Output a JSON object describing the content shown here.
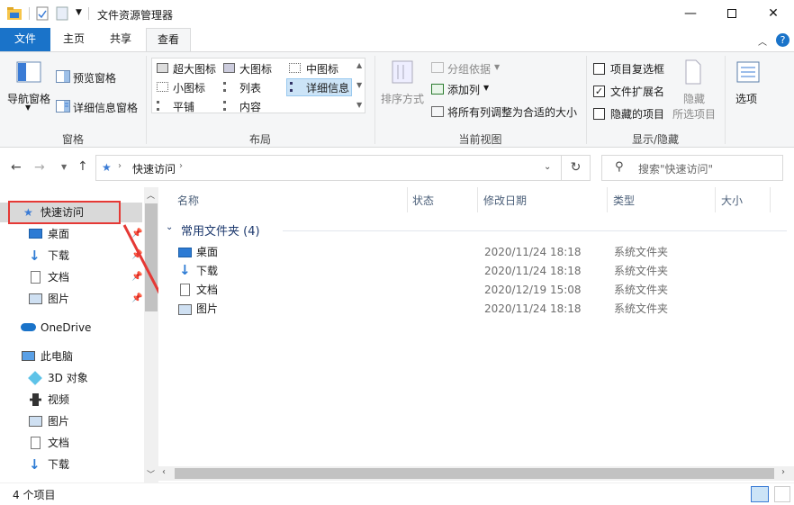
{
  "window": {
    "title": "文件资源管理器"
  },
  "tabs": [
    {
      "label": "文件"
    },
    {
      "label": "主页"
    },
    {
      "label": "共享"
    },
    {
      "label": "查看"
    }
  ],
  "ribbon": {
    "panes": {
      "nav_pane": "导航窗格",
      "preview_pane": "预览窗格",
      "details_pane": "详细信息窗格",
      "group_label": "窗格"
    },
    "layout": {
      "items": [
        "超大图标",
        "大图标",
        "中图标",
        "小图标",
        "列表",
        "详细信息",
        "平铺",
        "内容"
      ],
      "group_label": "布局"
    },
    "current_view": {
      "sort_by": "排序方式",
      "group_by": "分组依据",
      "add_column": "添加列",
      "fit_columns": "将所有列调整为合适的大小",
      "group_label": "当前视图"
    },
    "show_hide": {
      "item_checkboxes": "项目复选框",
      "file_extensions": "文件扩展名",
      "hidden_items": "隐藏的项目",
      "hide_selected": "隐藏",
      "hide_selected_2": "所选项目",
      "group_label": "显示/隐藏",
      "item_checkboxes_checked": false,
      "file_extensions_checked": true,
      "hidden_items_checked": false
    },
    "options": "选项"
  },
  "address": {
    "location": "快速访问",
    "search_placeholder": "搜索\"快速访问\""
  },
  "nav": {
    "items": [
      {
        "label": "快速访问"
      },
      {
        "label": "桌面"
      },
      {
        "label": "下载"
      },
      {
        "label": "文档"
      },
      {
        "label": "图片"
      },
      {
        "label": "OneDrive"
      },
      {
        "label": "此电脑"
      },
      {
        "label": "3D 对象"
      },
      {
        "label": "视频"
      },
      {
        "label": "图片"
      },
      {
        "label": "文档"
      },
      {
        "label": "下载"
      }
    ]
  },
  "columns": [
    "名称",
    "状态",
    "修改日期",
    "类型",
    "大小"
  ],
  "group_header": "常用文件夹 (4)",
  "files": [
    {
      "name": "桌面",
      "date": "2020/11/24 18:18",
      "type": "系统文件夹"
    },
    {
      "name": "下载",
      "date": "2020/11/24 18:18",
      "type": "系统文件夹"
    },
    {
      "name": "文档",
      "date": "2020/12/19 15:08",
      "type": "系统文件夹"
    },
    {
      "name": "图片",
      "date": "2020/11/24 18:18",
      "type": "系统文件夹"
    }
  ],
  "status": {
    "item_count": "4 个项目"
  },
  "colors": {
    "accent": "#1a73c9",
    "annotation": "#e53935",
    "folder": "#f7c54a"
  }
}
